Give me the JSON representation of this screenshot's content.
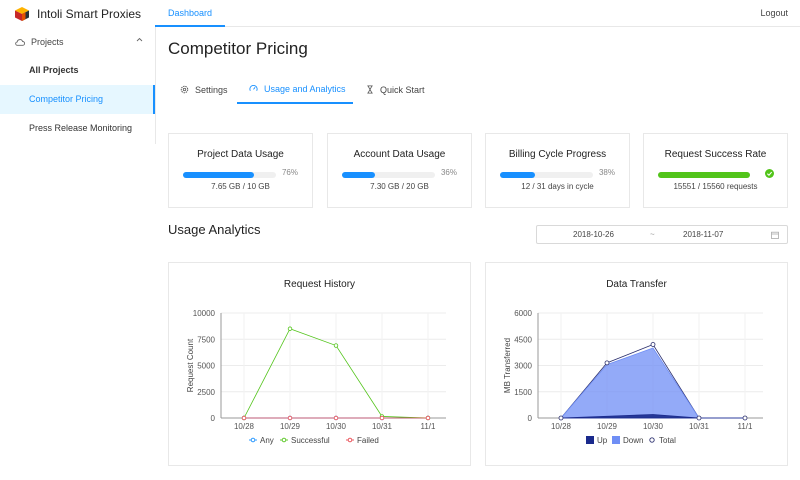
{
  "app": {
    "title": "Intoli Smart Proxies"
  },
  "nav": {
    "tab": "Dashboard",
    "logout": "Logout"
  },
  "sidebar": {
    "group": "Projects",
    "items": [
      "All Projects",
      "Competitor Pricing",
      "Press Release Monitoring"
    ]
  },
  "page": {
    "title": "Competitor Pricing"
  },
  "tabs": [
    "Settings",
    "Usage and Analytics",
    "Quick Start"
  ],
  "stats": [
    {
      "title": "Project Data Usage",
      "value": 76,
      "pct": "76%",
      "sub": "7.65 GB / 10 GB"
    },
    {
      "title": "Account Data Usage",
      "value": 36,
      "pct": "36%",
      "sub": "7.30 GB / 20 GB"
    },
    {
      "title": "Billing Cycle Progress",
      "value": 38,
      "pct": "38%",
      "sub": "12 / 31 days in cycle"
    },
    {
      "title": "Request Success Rate",
      "value": 100,
      "pct": "",
      "sub": "15551 / 15560 requests"
    }
  ],
  "colors": {
    "accent": "#1890ff",
    "success": "#52c41a"
  },
  "analytics": {
    "title": "Usage Analytics",
    "start": "2018-10-26",
    "separator": "~",
    "end": "2018-11-07"
  },
  "chart_data": [
    {
      "type": "line",
      "title": "Request History",
      "ylabel": "Request Count",
      "categories": [
        "10/28",
        "10/29",
        "10/30",
        "10/31",
        "11/1"
      ],
      "ylim": [
        0,
        10000
      ],
      "yticks": [
        0,
        2500,
        5000,
        7500,
        10000
      ],
      "series": [
        {
          "name": "Any",
          "color": "#1890ff",
          "values": [
            0,
            0,
            0,
            0,
            0
          ]
        },
        {
          "name": "Successful",
          "color": "#52c41a",
          "values": [
            0,
            8500,
            6900,
            150,
            0
          ]
        },
        {
          "name": "Failed",
          "color": "#e8464e",
          "values": [
            0,
            0,
            0,
            0,
            0
          ]
        }
      ]
    },
    {
      "type": "area",
      "title": "Data Transfer",
      "ylabel": "MB Transferred",
      "categories": [
        "10/28",
        "10/29",
        "10/30",
        "10/31",
        "11/1"
      ],
      "ylim": [
        0,
        6000
      ],
      "yticks": [
        0,
        1500,
        3000,
        4500,
        6000
      ],
      "series": [
        {
          "name": "Up",
          "color": "#1a2a8c",
          "values": [
            0,
            100,
            200,
            0,
            0
          ]
        },
        {
          "name": "Down",
          "color": "#6f8ef5",
          "values": [
            0,
            3050,
            4000,
            0,
            0
          ]
        },
        {
          "name": "Total",
          "color": "#2b2f6e",
          "values": [
            0,
            3150,
            4200,
            0,
            0
          ]
        }
      ]
    }
  ]
}
